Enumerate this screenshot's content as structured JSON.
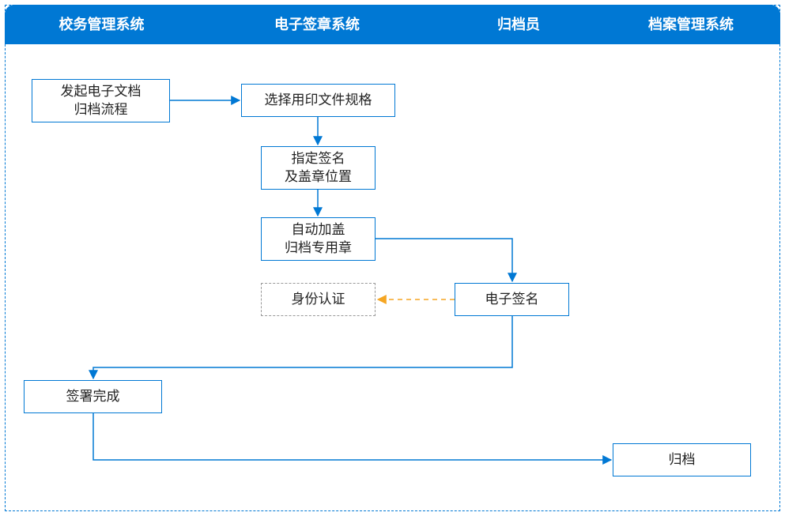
{
  "lanes": {
    "school": "校务管理系统",
    "esign": "电子签章系统",
    "archiver": "归档员",
    "records": "档案管理系统"
  },
  "nodes": {
    "start_line1": "发起电子文档",
    "start_line2": "归档流程",
    "select_format": "选择用印文件规格",
    "specify_line1": "指定签名",
    "specify_line2": "及盖章位置",
    "stamp_line1": "自动加盖",
    "stamp_line2": "归档专用章",
    "identity": "身份认证",
    "esign": "电子签名",
    "signed": "签署完成",
    "archive": "归档"
  },
  "colors": {
    "primary": "#0078d4",
    "dashed_orange": "#f5a623"
  },
  "chart_data": {
    "type": "table",
    "description": "Swimlane flowchart for electronic document archiving with e-signature",
    "lanes": [
      "校务管理系统",
      "电子签章系统",
      "归档员",
      "档案管理系统"
    ],
    "steps": [
      {
        "id": "start",
        "lane": "校务管理系统",
        "label": "发起电子文档归档流程"
      },
      {
        "id": "select_format",
        "lane": "电子签章系统",
        "label": "选择用印文件规格"
      },
      {
        "id": "specify_pos",
        "lane": "电子签章系统",
        "label": "指定签名及盖章位置"
      },
      {
        "id": "auto_stamp",
        "lane": "电子签章系统",
        "label": "自动加盖归档专用章"
      },
      {
        "id": "identity",
        "lane": "电子签章系统",
        "label": "身份认证",
        "style": "dashed"
      },
      {
        "id": "esign",
        "lane": "归档员",
        "label": "电子签名"
      },
      {
        "id": "signed",
        "lane": "校务管理系统",
        "label": "签署完成"
      },
      {
        "id": "archive",
        "lane": "档案管理系统",
        "label": "归档"
      }
    ],
    "edges": [
      {
        "from": "start",
        "to": "select_format"
      },
      {
        "from": "select_format",
        "to": "specify_pos"
      },
      {
        "from": "specify_pos",
        "to": "auto_stamp"
      },
      {
        "from": "auto_stamp",
        "to": "esign"
      },
      {
        "from": "esign",
        "to": "identity",
        "style": "dashed"
      },
      {
        "from": "esign",
        "to": "signed"
      },
      {
        "from": "signed",
        "to": "archive"
      }
    ]
  }
}
